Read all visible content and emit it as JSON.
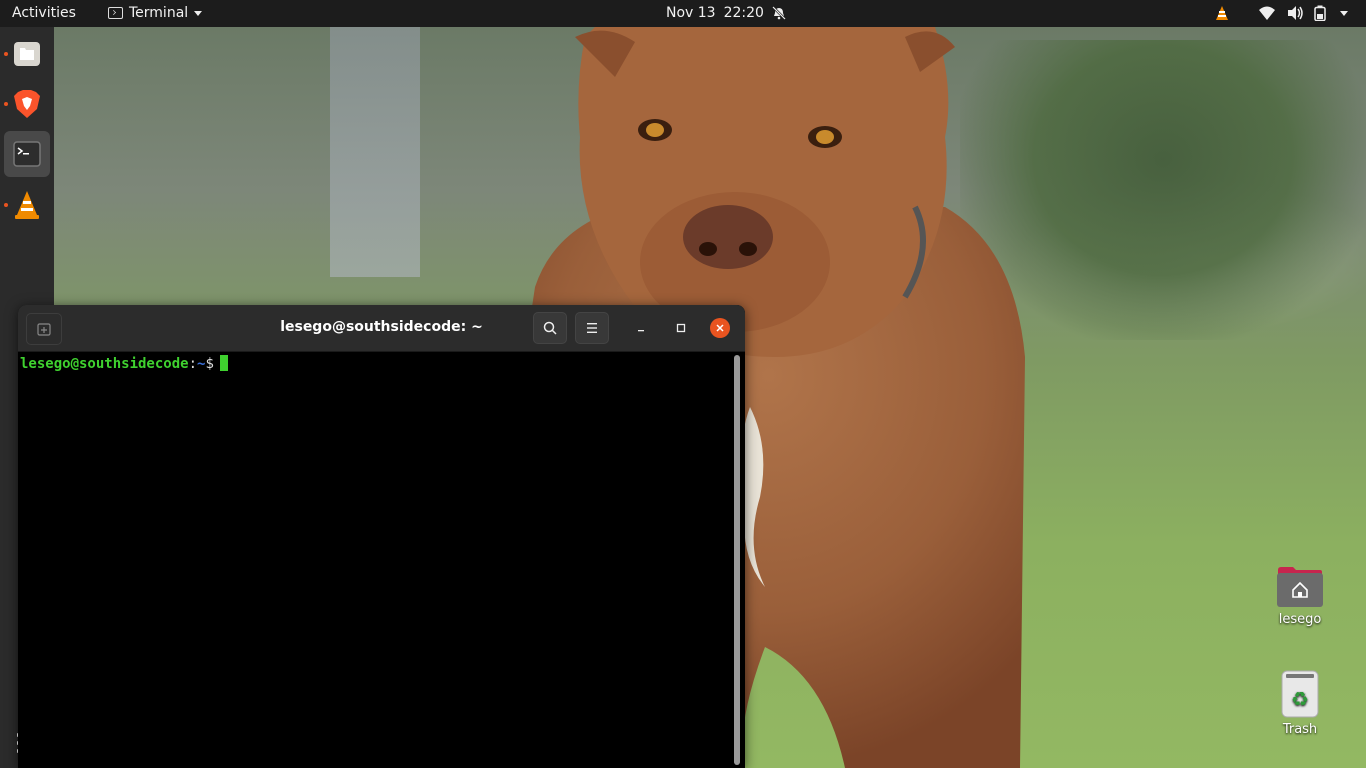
{
  "topbar": {
    "activities_label": "Activities",
    "app_menu_label": "Terminal",
    "date": "Nov 13",
    "time": "22:20"
  },
  "dock": {
    "items": [
      {
        "name": "files",
        "icon": "files-icon",
        "running": true,
        "active": false
      },
      {
        "name": "brave",
        "icon": "brave-icon",
        "running": true,
        "active": false
      },
      {
        "name": "terminal",
        "icon": "terminal-icon",
        "running": true,
        "active": true
      },
      {
        "name": "vlc",
        "icon": "vlc-icon",
        "running": true,
        "active": false
      }
    ],
    "show_apps_icon": "apps-grid-icon"
  },
  "terminal": {
    "title": "lesego@southsidecode: ~",
    "prompt_user_host": "lesego@southsidecode",
    "prompt_sep": ":",
    "prompt_path": "~",
    "prompt_symbol": "$",
    "colors": {
      "user": "#3fd12f",
      "path": "#3a6fd8",
      "cursor": "#3fd12f",
      "close": "#e95420"
    }
  },
  "desktop": {
    "icons": [
      {
        "label": "lesego",
        "icon": "home-folder-icon"
      },
      {
        "label": "Trash",
        "icon": "trash-icon"
      }
    ]
  }
}
